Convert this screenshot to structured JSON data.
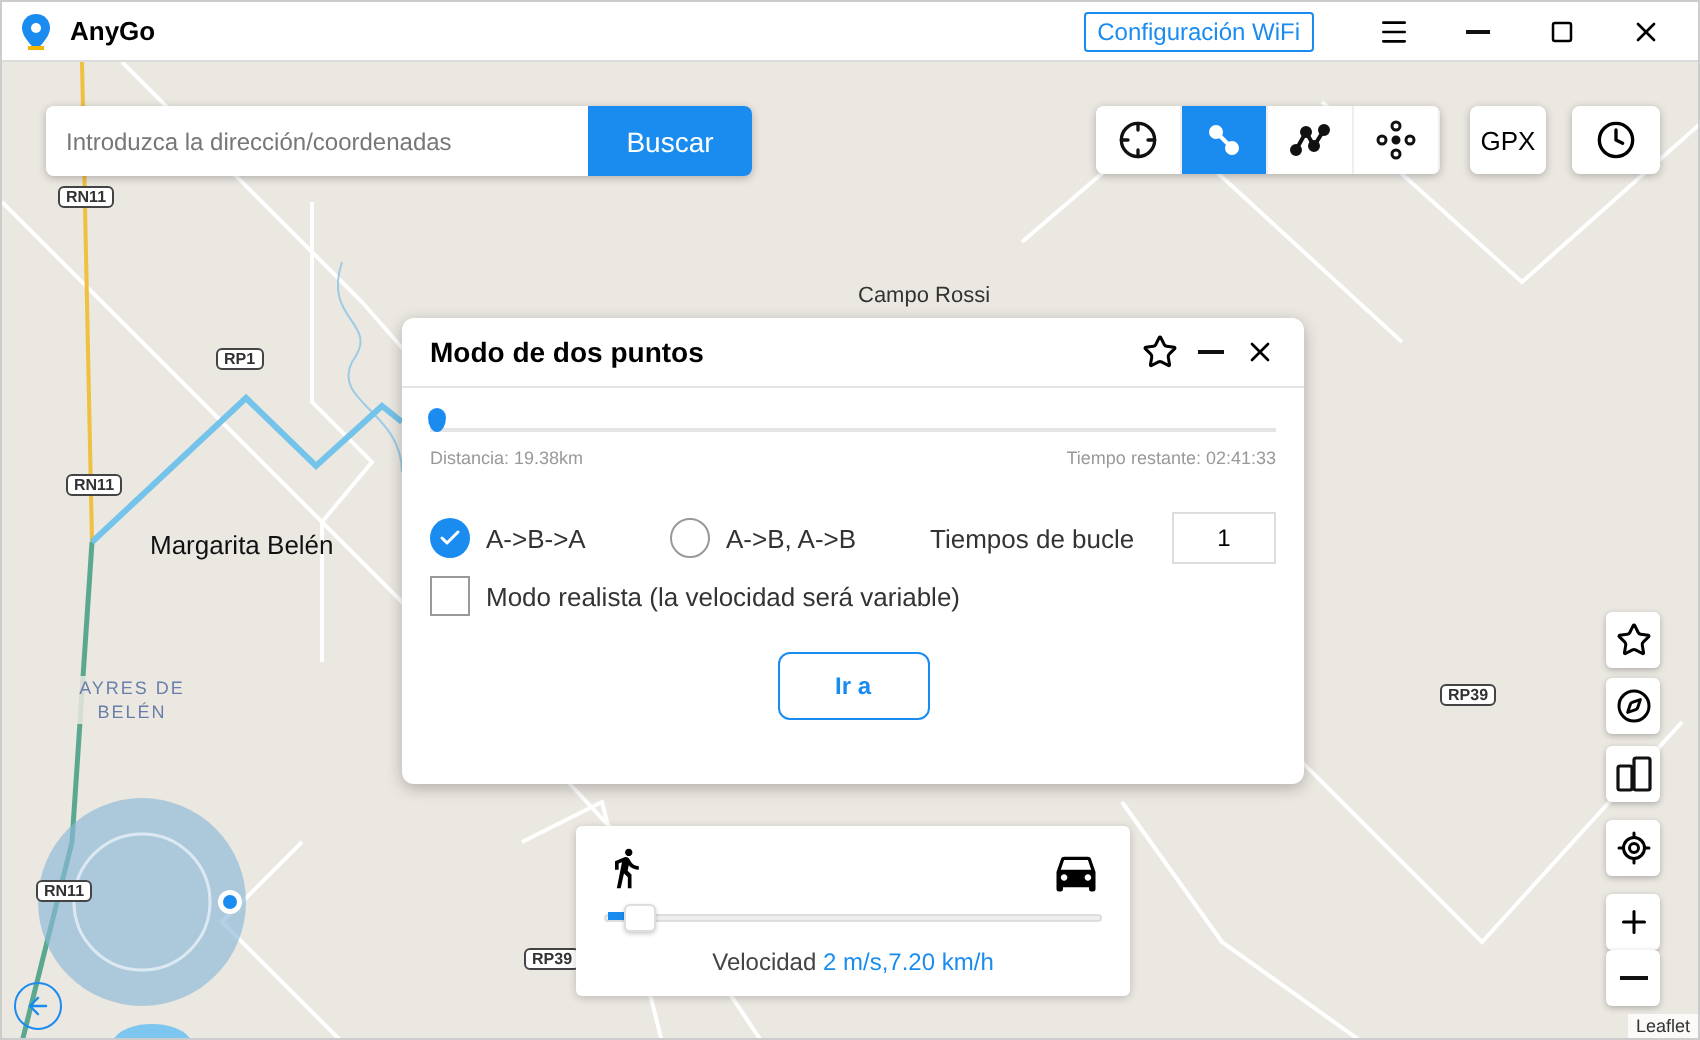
{
  "window": {
    "title": "AnyGo",
    "wifi_button": "Configuración WiFi"
  },
  "search": {
    "placeholder": "Introduzca la dirección/coordenadas",
    "button": "Buscar"
  },
  "modes": [
    {
      "kind": "teleport",
      "selected": false
    },
    {
      "kind": "two-spot",
      "selected": true
    },
    {
      "kind": "multi-spot",
      "selected": false
    },
    {
      "kind": "joystick",
      "selected": false
    }
  ],
  "gpx_button": "GPX",
  "map_labels": [
    {
      "kind": "road",
      "text": "RN11"
    },
    {
      "kind": "road",
      "text": "RP1"
    },
    {
      "kind": "road",
      "text": "RN11"
    },
    {
      "kind": "road",
      "text": "RN11"
    },
    {
      "kind": "road",
      "text": "RP39"
    },
    {
      "kind": "road",
      "text": "RP39"
    },
    {
      "kind": "place",
      "text": "Campo Rossi"
    },
    {
      "kind": "town",
      "text": "Margarita Belén"
    },
    {
      "kind": "district",
      "text": "AYRES DE BELÉN"
    }
  ],
  "route_panel": {
    "title": "Modo de dos puntos",
    "level": 0,
    "distance": "Distancia: 19.38km",
    "remaining": "Tiempo restante: 02:41:33",
    "options": [
      {
        "label": "A->B->A",
        "selected": true
      },
      {
        "label": "A->B, A->B",
        "selected": false
      }
    ],
    "loop_label": "Tiempos de bucle",
    "loop_value": "1",
    "realistic": {
      "label": "Modo realista (la velocidad será variable)",
      "checked": false
    },
    "go_button": "Ir a"
  },
  "speed_panel": {
    "level": 0.05,
    "label": "Velocidad",
    "value": "2 m/s,7.20 km/h"
  },
  "attribution": "Leaflet"
}
